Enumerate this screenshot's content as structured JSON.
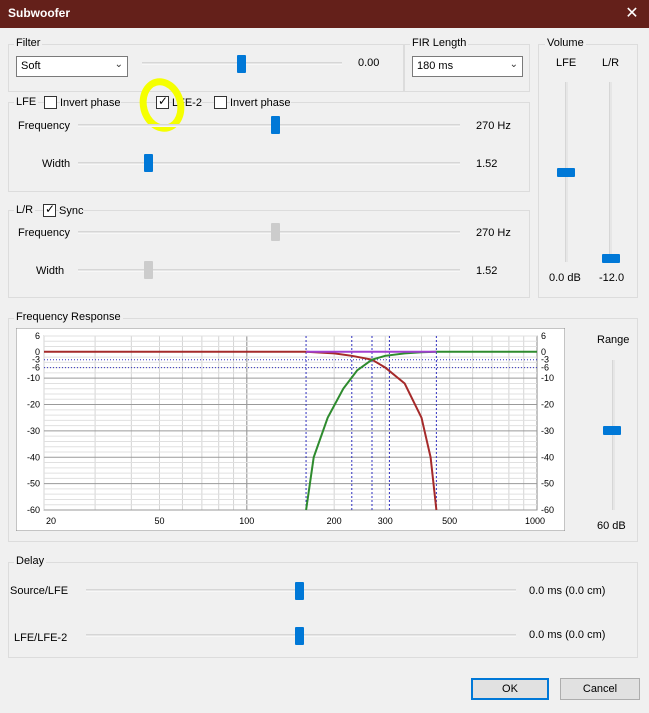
{
  "window": {
    "title": "Subwoofer",
    "close_glyph": "✕"
  },
  "filter": {
    "group_label": "Filter",
    "type_value": "Soft",
    "slider_value": 0.0,
    "value_text": "0.00"
  },
  "fir": {
    "group_label": "FIR Length",
    "value": "180 ms"
  },
  "volume": {
    "group_label": "Volume",
    "lfe_label": "LFE",
    "lr_label": "L/R",
    "lfe_value": "0.0 dB",
    "lr_value": "-12.0",
    "lfe_level": 0.35,
    "lr_level": 1.0
  },
  "lfe": {
    "group_label": "LFE",
    "invert_label": "Invert phase",
    "invert_checked": false,
    "lfe2_label": "LFE-2",
    "lfe2_checked": true,
    "invert2_label": "Invert phase",
    "invert2_checked": false,
    "freq_label": "Frequency",
    "freq_value": "270 Hz",
    "freq_pos": 0.52,
    "width_label": "Width",
    "width_value": "1.52",
    "width_pos": 0.18
  },
  "lr": {
    "group_label": "L/R",
    "sync_label": "Sync",
    "sync_checked": true,
    "freq_label": "Frequency",
    "freq_value": "270 Hz",
    "freq_pos": 0.52,
    "width_label": "Width",
    "width_value": "1.52",
    "width_pos": 0.18
  },
  "freq_response": {
    "group_label": "Frequency Response",
    "range_label": "Range",
    "range_value": "60 dB",
    "range_level": 0.45
  },
  "delay": {
    "group_label": "Delay",
    "source_label": "Source/LFE",
    "source_value": "0.0 ms (0.0 cm)",
    "lfe2_label": "LFE/LFE-2",
    "lfe2_value": "0.0 ms (0.0 cm)"
  },
  "buttons": {
    "ok": "OK",
    "cancel": "Cancel"
  },
  "colors": {
    "accent": "#0078d7",
    "titlebar": "#64201a",
    "lowpass": "#a52a2a",
    "highpass": "#2e8b2e",
    "flat": "#a040d0",
    "marker": "#3030c0"
  },
  "chart_data": {
    "type": "line",
    "x_scale": "log",
    "xlim": [
      20,
      1000
    ],
    "x_ticks": [
      "20",
      "50",
      "100",
      "200",
      "300",
      "500",
      "1000"
    ],
    "ylim": [
      -60,
      6
    ],
    "y_ticks": [
      "6",
      "0",
      "-3",
      "-6",
      "-10",
      "-20",
      "-30",
      "-40",
      "-50",
      "-60"
    ],
    "markers_x": [
      160,
      230,
      270,
      310,
      450
    ],
    "series": [
      {
        "color": "#a52a2a",
        "x": [
          20,
          100,
          160,
          200,
          230,
          270,
          300,
          350,
          400,
          430,
          450
        ],
        "y": [
          0,
          0,
          0,
          -0.6,
          -1.5,
          -3,
          -6,
          -12,
          -25,
          -40,
          -60
        ]
      },
      {
        "color": "#2e8b2e",
        "x": [
          160,
          170,
          190,
          215,
          240,
          270,
          300,
          350,
          400,
          450,
          500,
          1000
        ],
        "y": [
          -60,
          -40,
          -25,
          -14,
          -7,
          -3,
          -1.5,
          -0.6,
          -0.2,
          0,
          0,
          0
        ]
      },
      {
        "color": "#a040d0",
        "x": [
          160,
          450
        ],
        "y": [
          0,
          0
        ]
      }
    ]
  }
}
